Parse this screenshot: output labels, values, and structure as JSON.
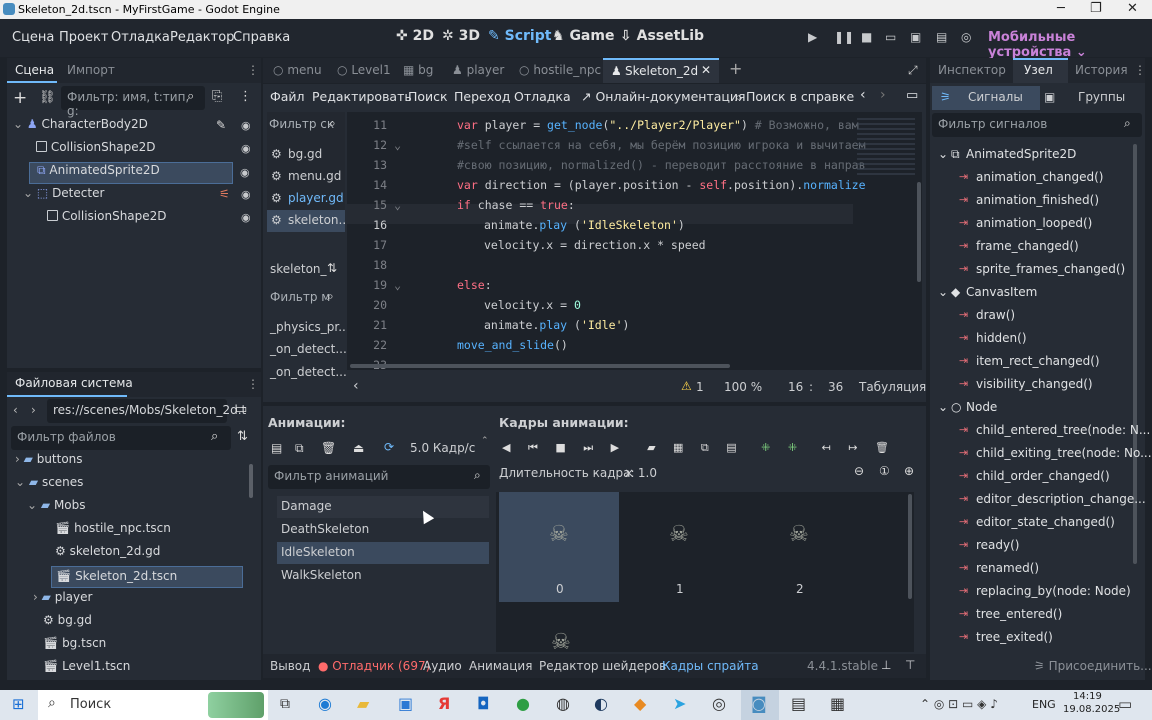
{
  "window": {
    "title": "Skeleton_2d.tscn - MyFirstGame - Godot Engine"
  },
  "menu": {
    "items": [
      "Сцена",
      "Проект",
      "Отладка",
      "Редактор",
      "Справка"
    ],
    "workspaces": [
      "2D",
      "3D",
      "Script",
      "Game",
      "AssetLib"
    ],
    "mobile": "Мобильные устройства"
  },
  "scene_dock": {
    "tabs": [
      "Сцена",
      "Импорт"
    ],
    "filter_placeholder": "Фильтр: имя, t:тип, g:",
    "nodes": [
      "CharacterBody2D",
      "CollisionShape2D",
      "AnimatedSprite2D",
      "Detecter",
      "CollisionShape2D"
    ]
  },
  "fs_dock": {
    "title": "Файловая система",
    "path": "res://scenes/Mobs/Skeleton_2d.t",
    "filter_placeholder": "Фильтр файлов",
    "items": [
      "buttons",
      "scenes",
      "Mobs",
      "hostile_npc.tscn",
      "skeleton_2d.gd",
      "Skeleton_2d.tscn",
      "player",
      "bg.gd",
      "bg.tscn",
      "Level1.tscn"
    ]
  },
  "editor_tabs": [
    "menu",
    "Level1",
    "bg",
    "player",
    "hostile_npc",
    "Skeleton_2d"
  ],
  "script_menu": [
    "Файл",
    "Редактировать",
    "Поиск",
    "Переход",
    "Отладка"
  ],
  "script_menu_right": {
    "docs": "Онлайн-документация",
    "help": "Поиск в справке"
  },
  "script_list": {
    "filter": "Фильтр ск",
    "files": [
      "bg.gd",
      "menu.gd",
      "player.gd",
      "skeleton..."
    ],
    "current": "skeleton_",
    "method_filter": "Фильтр м",
    "methods": [
      "_physics_pr...",
      "_on_detect...",
      "_on_detect..."
    ]
  },
  "code": {
    "line_numbers": [
      "11",
      "12",
      "13",
      "14",
      "15",
      "16",
      "17",
      "18",
      "19",
      "20",
      "21",
      "22",
      "23"
    ]
  },
  "status": {
    "warnings": "1",
    "zoom": "100 %",
    "line": "16",
    "col": "36",
    "indent": "Табуляция"
  },
  "anim_panel": {
    "title": "Анимации:",
    "fps": "5.0 Кадр/с",
    "filter_placeholder": "Фильтр анимаций",
    "animations": [
      "Damage",
      "DeathSkeleton",
      "IdleSkeleton",
      "WalkSkeleton"
    ],
    "selected": "IdleSkeleton"
  },
  "frames_panel": {
    "title": "Кадры анимации:",
    "duration_label": "Длительность кадра:",
    "duration_value": "× 1.0",
    "frames": [
      "0",
      "1",
      "2"
    ]
  },
  "bottom_bar": {
    "items": [
      "Вывод",
      "Отладчик (697)",
      "Аудио",
      "Анимация",
      "Редактор шейдеров",
      "Кадры спрайта"
    ],
    "version": "4.4.1.stable"
  },
  "inspector": {
    "tabs": [
      "Инспектор",
      "Узел",
      "История"
    ],
    "subtabs": [
      "Сигналы",
      "Группы"
    ],
    "filter_placeholder": "Фильтр сигналов",
    "groups": [
      "AnimatedSprite2D",
      "CanvasItem",
      "Node"
    ],
    "sprite_signals": [
      "animation_changed()",
      "animation_finished()",
      "animation_looped()",
      "frame_changed()",
      "sprite_frames_changed()"
    ],
    "canvas_signals": [
      "draw()",
      "hidden()",
      "item_rect_changed()",
      "visibility_changed()"
    ],
    "node_signals": [
      "child_entered_tree(node: N...",
      "child_exiting_tree(node: No...",
      "child_order_changed()",
      "editor_description_change...",
      "editor_state_changed()",
      "ready()",
      "renamed()",
      "replacing_by(node: Node)",
      "tree_entered()",
      "tree_exited()"
    ],
    "connect": "Присоединить..."
  },
  "taskbar": {
    "search": "Поиск",
    "lang": "ENG",
    "time": "14:19",
    "date": "19.08.2025"
  }
}
